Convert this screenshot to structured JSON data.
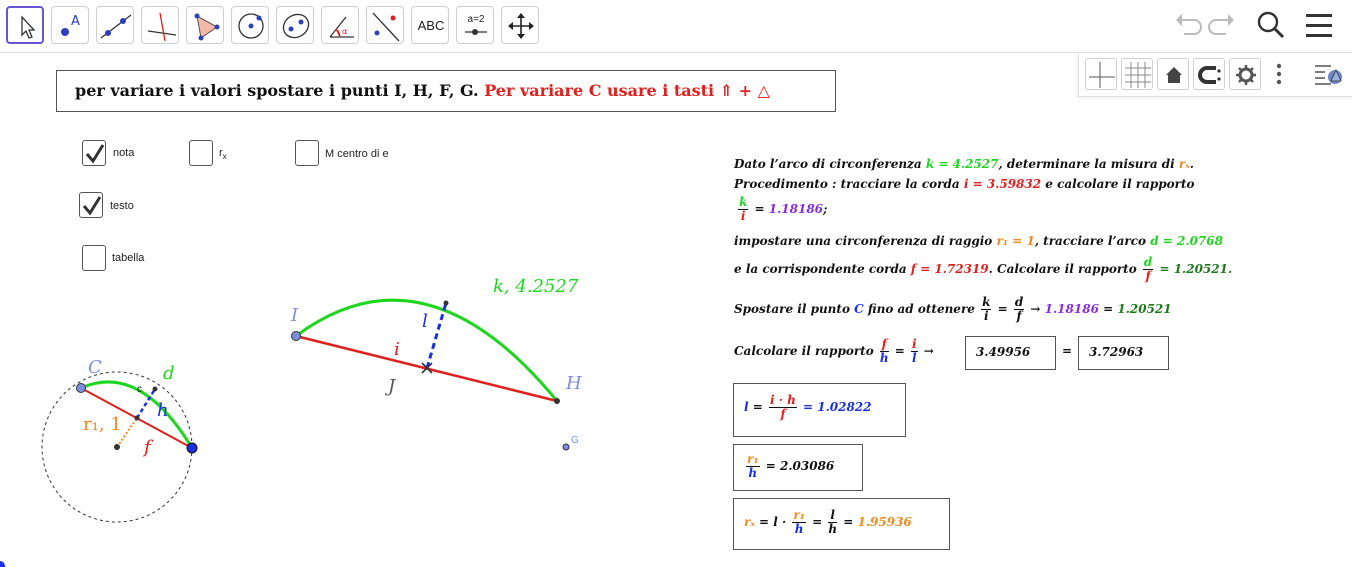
{
  "toolbar": {
    "text_tool_label": "ABC",
    "slider_tool_label": "a=2"
  },
  "banner": {
    "part1": "per variare i valori spostare i punti I, H, F, G.",
    "part2": "Per variare C  usare i tasti  ⇑ + △"
  },
  "checkboxes": [
    {
      "label": "nota",
      "checked": true
    },
    {
      "label": "r",
      "sub": "x",
      "checked": false
    },
    {
      "label": "M centro di e",
      "checked": false
    },
    {
      "label": "testo",
      "checked": true
    },
    {
      "label": "tabella",
      "checked": false
    }
  ],
  "canvas": {
    "label_I": "I",
    "label_H": "H",
    "label_J": "J",
    "label_i": "i",
    "label_l": "l",
    "label_k": "k, 4.2527",
    "label_G": "G",
    "label_C": "C",
    "label_d": "d",
    "label_c": "c",
    "label_h": "h",
    "label_f": "f",
    "label_r1": "r₁, 1"
  },
  "text": {
    "line1_a": "Dato l’arco di circonferenza ",
    "line1_k": "k = 4.2527",
    "line1_b": ",  determinare la misura di ",
    "line1_rx": "rₓ",
    "line1_c": ".",
    "line2_a": "Procedimento : tracciare la corda ",
    "line2_i": "i = 3.59832",
    "line2_b": " e calcolare il rapporto",
    "line3_num": "k",
    "line3_den": "i",
    "line3_eq": " = ",
    "line3_val": "1.18186",
    "line3_end": ";",
    "line4_a": "impostare una circonferenza di raggio ",
    "line4_r1": "r₁ = 1",
    "line4_b": ",  tracciare l’arco ",
    "line4_d": "d = 2.0768",
    "line5_a": "e la corrispondente corda ",
    "line5_f": "f = 1.72319",
    "line5_b": ".  Calcolare il rapporto ",
    "line5_num": "d",
    "line5_den": "f",
    "line5_val": " = 1.20521.",
    "line6_a": "Spostare il punto ",
    "line6_C": "C",
    "line6_b": " fino ad ottenere ",
    "line6_num1": "k",
    "line6_den1": "i",
    "line6_eq": " = ",
    "line6_num2": "d",
    "line6_den2": "f",
    "line6_arrow": " → ",
    "line6_v1": "1.18186",
    "line6_eq2": " = ",
    "line6_v2": "1.20521",
    "line7_a": "Calcolare il rapporto ",
    "line7_num1": "f",
    "line7_den1": "h",
    "line7_eq": " = ",
    "line7_num2": "i",
    "line7_den2": "l",
    "line7_arrow": " → ",
    "box1": "3.49956",
    "box_eq": "=",
    "box2": "3.72963",
    "res1_l": "l",
    "res1_eq": " = ",
    "res1_num": "i · h",
    "res1_den": "f",
    "res1_val": " = 1.02822",
    "res2_num": "r₁",
    "res2_den": "h",
    "res2_val": " = 2.03086",
    "res3_rx": "rₓ",
    "res3_a": " = l · ",
    "res3_num1": "r₁",
    "res3_den1": "h",
    "res3_eq": " = ",
    "res3_num2": "l",
    "res3_den2": "h",
    "res3_eq2": " = ",
    "res3_val": "1.95936"
  },
  "colors": {
    "arc": "#1ed61e",
    "chord": "#e0201d",
    "dashed": "#1a2fe0",
    "radius": "#f08a1c",
    "point": "#7b8fe0",
    "text_accent": "#1a2fe0"
  }
}
